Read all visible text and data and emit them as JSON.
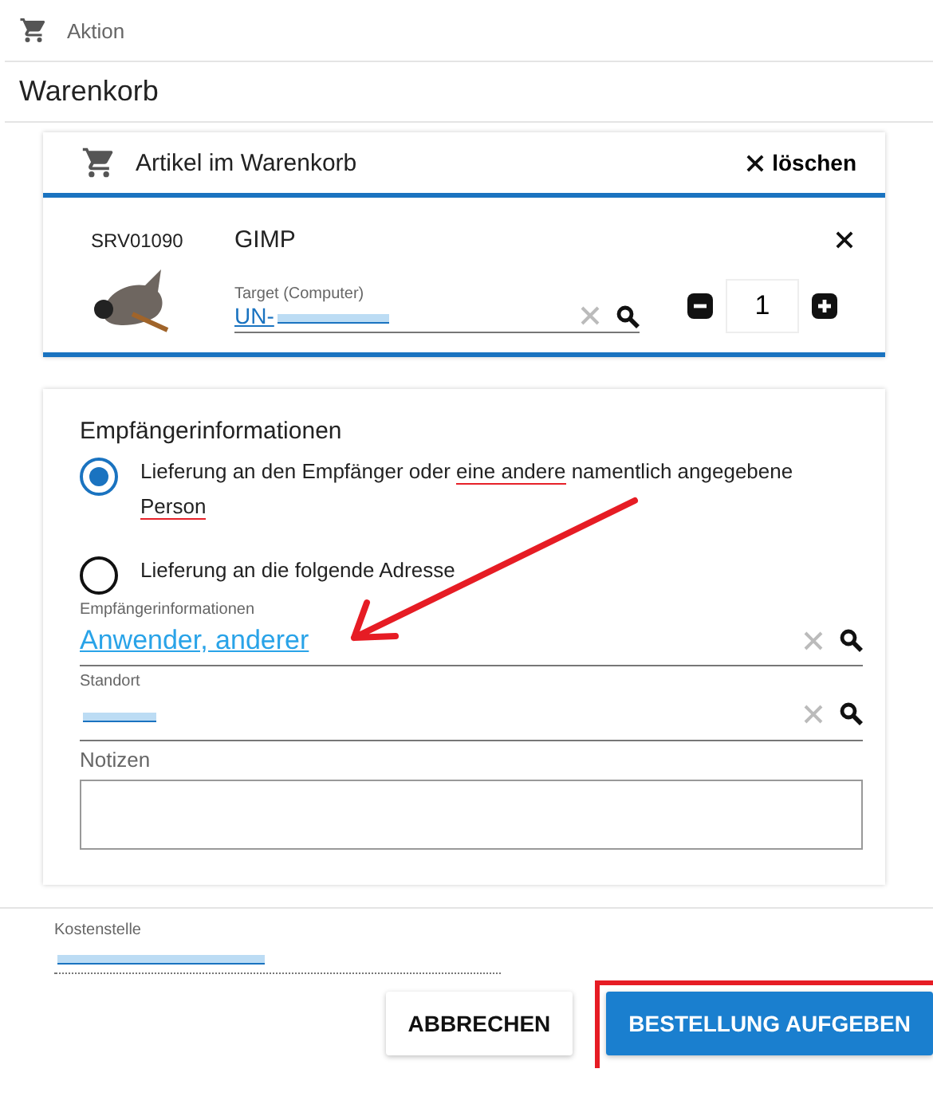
{
  "breadcrumb": {
    "label": "Aktion"
  },
  "page_title": "Warenkorb",
  "cart": {
    "title": "Artikel im Warenkorb",
    "clear_label": "löschen",
    "items": [
      {
        "code": "SRV01090",
        "name": "GIMP",
        "target_label": "Target (Computer)",
        "target_value": "UN-",
        "target_redacted": true,
        "quantity": "1"
      }
    ]
  },
  "recipient": {
    "title": "Empfängerinformationen",
    "options": [
      {
        "selected": true,
        "segments": [
          {
            "text": "Lieferung an den Empfänger oder ",
            "underlined": false
          },
          {
            "text": "eine andere",
            "underlined": true
          },
          {
            "text": " namentlich angegebene ",
            "underlined": false
          },
          {
            "text": "Person",
            "underlined": true
          }
        ]
      },
      {
        "selected": false,
        "segments": [
          {
            "text": "Lieferung an die folgende Adresse",
            "underlined": false
          }
        ]
      }
    ],
    "fields": [
      {
        "label": "Empfängerinformationen",
        "value": "Anwender, anderer",
        "redacted": false
      },
      {
        "label": "Standort",
        "redacted": true
      }
    ],
    "notes_label": "Notizen"
  },
  "cost_center": {
    "label": "Kostenstelle",
    "redacted": true
  },
  "buttons": [
    {
      "label": "ABBRECHEN",
      "kind": "secondary",
      "highlighted": false
    },
    {
      "label": "BESTELLUNG AUFGEBEN",
      "kind": "primary",
      "highlighted": true
    }
  ],
  "annotation_arrow": true
}
